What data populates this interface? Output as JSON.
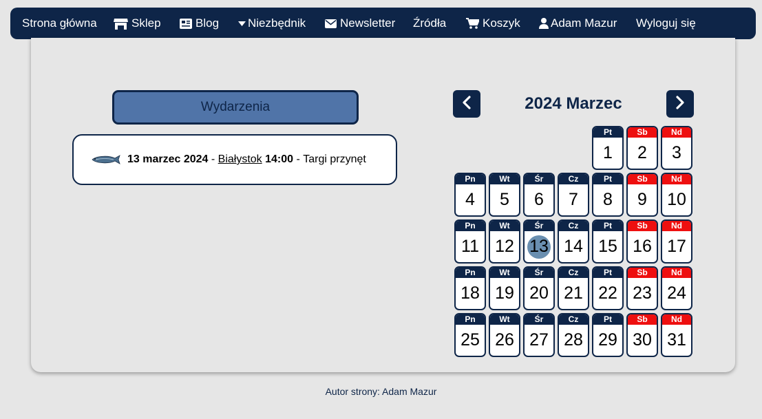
{
  "nav": {
    "home": "Strona główna",
    "shop": "Sklep",
    "blog": "Blog",
    "essentials": "Niezbędnik",
    "newsletter": "Newsletter",
    "sources": "Źródła",
    "cart": "Koszyk",
    "user": "Adam Mazur",
    "logout": "Wyloguj się"
  },
  "events": {
    "button_label": "Wydarzenia",
    "items": [
      {
        "date": "13 marzec 2024",
        "sep1": " - ",
        "city": "Białystok",
        "time": " 14:00",
        "sep2": " - ",
        "title": "Targi przynęt"
      }
    ]
  },
  "calendar": {
    "title": "2024 Marzec",
    "weekday_labels": [
      "Pn",
      "Wt",
      "Śr",
      "Cz",
      "Pt",
      "Sb",
      "Nd"
    ],
    "first_weekday_index": 4,
    "days_in_month": 31,
    "today": 13,
    "colors": {
      "header": "#0e2548",
      "weekend": "#ee0f0f",
      "today": "#6a8fb0"
    }
  },
  "footer": {
    "text": "Autor strony: Adam Mazur"
  },
  "colors": {
    "navy": "#0e2548",
    "button_blue": "#5074a8",
    "background": "#e6e6e6"
  }
}
